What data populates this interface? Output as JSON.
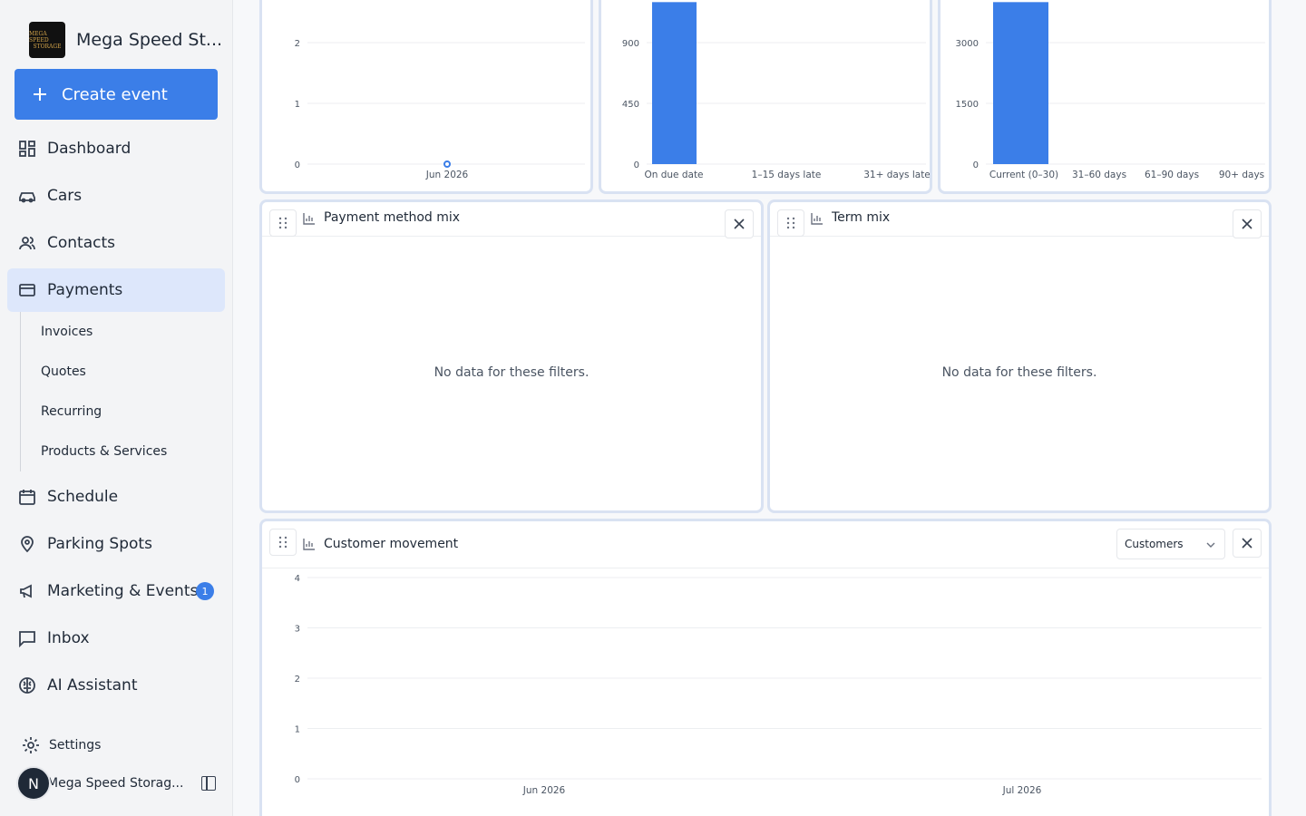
{
  "sidebar": {
    "brand_name": "Mega Speed St...",
    "brand_logo_text": [
      "MEGA SPEED",
      "STORAGE"
    ],
    "create_label": "Create event",
    "nav": {
      "dashboard": "Dashboard",
      "cars": "Cars",
      "contacts": "Contacts",
      "payments": "Payments",
      "schedule": "Schedule",
      "parking": "Parking Spots",
      "marketing": "Marketing & Events",
      "marketing_badge": "1",
      "inbox": "Inbox",
      "ai": "AI Assistant"
    },
    "subnav": [
      "Invoices",
      "Quotes",
      "Recurring",
      "Products & Services"
    ],
    "settings_label": "Settings",
    "user_initial": "N",
    "user_name": "Mega Speed Storag..."
  },
  "cards": {
    "payment_method_mix": {
      "title": "Payment method mix",
      "empty": "No data for these filters."
    },
    "term_mix": {
      "title": "Term mix",
      "empty": "No data for these filters."
    },
    "customer_movement": {
      "title": "Customer movement",
      "select_value": "Customers"
    }
  },
  "chart_data": [
    {
      "type": "line",
      "x": [
        "Jun 2026"
      ],
      "y_ticks": [
        "0",
        "1",
        "2"
      ],
      "series": [
        {
          "values": [
            0
          ]
        }
      ]
    },
    {
      "type": "bar",
      "categories": [
        "On due date",
        "1–15 days late",
        "31+ days late"
      ],
      "y_ticks": [
        "0",
        "450",
        "900"
      ],
      "series": [
        {
          "values": [
            1200,
            0,
            0
          ]
        }
      ]
    },
    {
      "type": "bar",
      "categories": [
        "Current (0–30)",
        "31–60 days",
        "61–90 days",
        "90+ days"
      ],
      "y_ticks": [
        "0",
        "1500",
        "3000"
      ],
      "series": [
        {
          "values": [
            4000,
            0,
            0,
            0
          ]
        }
      ]
    },
    {
      "type": "line",
      "x": [
        "Jun 2026",
        "Jul 2026"
      ],
      "y_ticks": [
        "0",
        "1",
        "2",
        "3",
        "4"
      ],
      "ylim": [
        0,
        4
      ],
      "series": []
    }
  ],
  "colors": {
    "accent": "#3b7ee8",
    "active_nav": "#dde7fb",
    "card_border": "#d9e2f2"
  }
}
